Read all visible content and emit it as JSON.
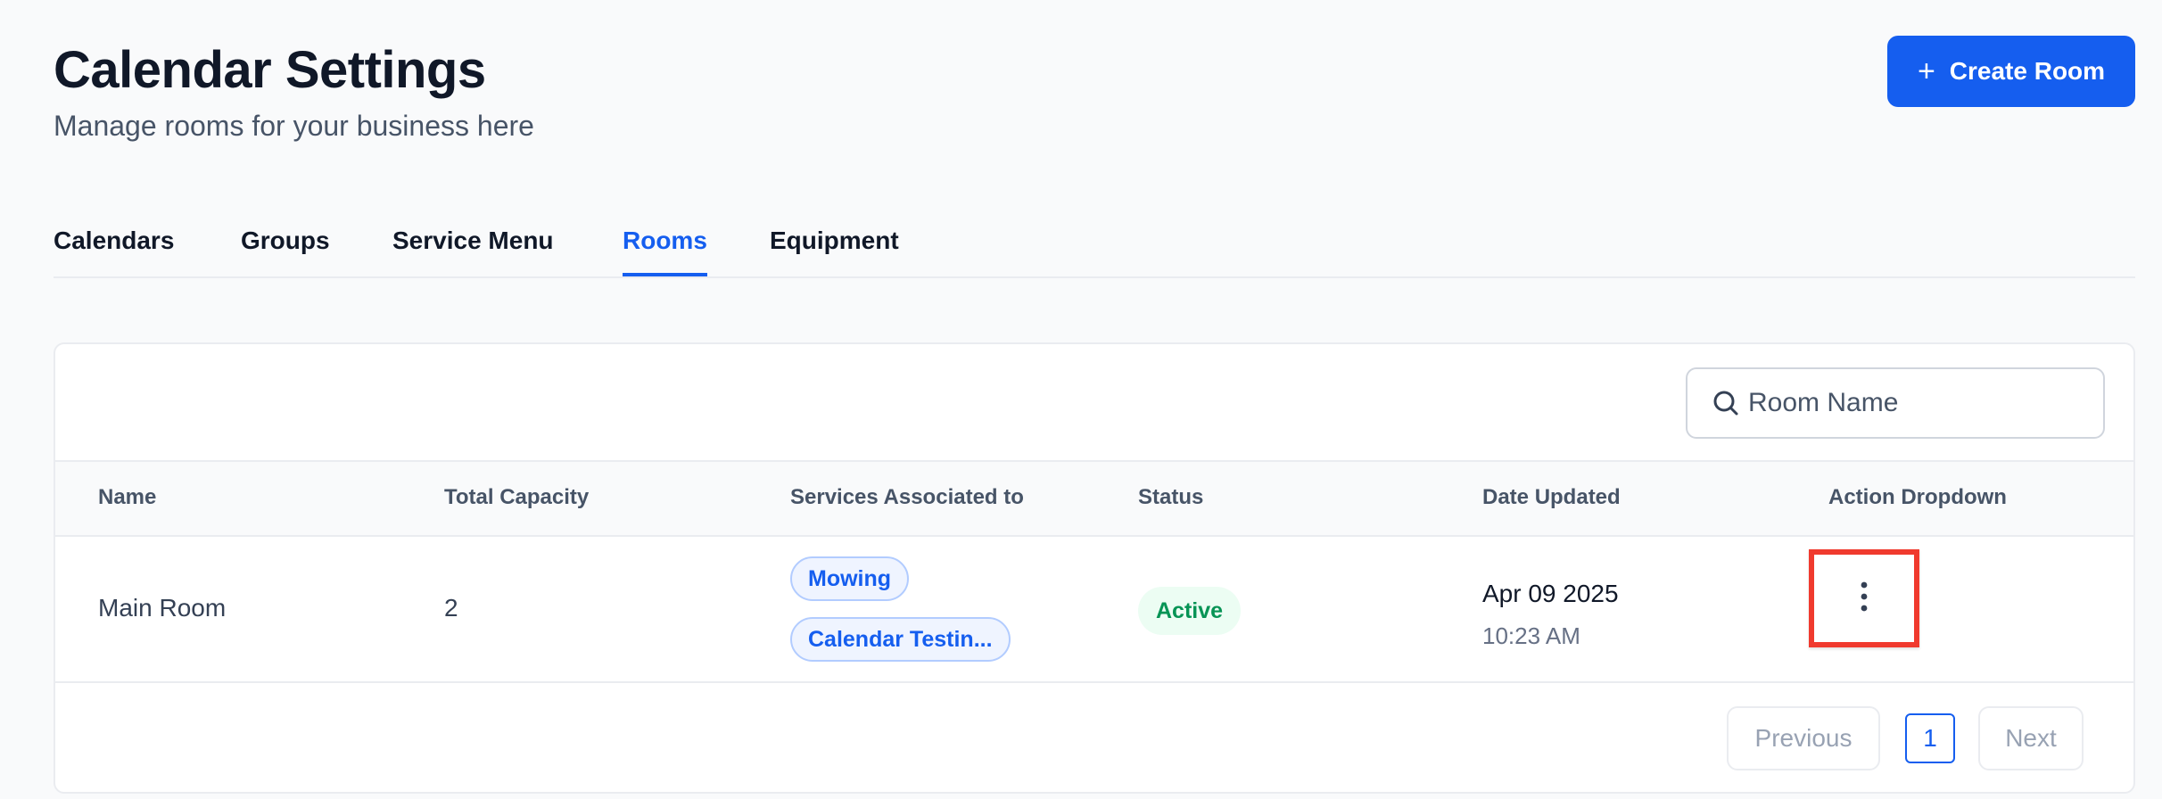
{
  "header": {
    "title": "Calendar Settings",
    "subtitle": "Manage rooms for your business here",
    "create_button": {
      "icon": "plus-icon",
      "label": "Create Room"
    }
  },
  "tabs": [
    {
      "label": "Calendars",
      "active": false
    },
    {
      "label": "Groups",
      "active": false
    },
    {
      "label": "Service Menu",
      "active": false
    },
    {
      "label": "Rooms",
      "active": true
    },
    {
      "label": "Equipment",
      "active": false
    }
  ],
  "search": {
    "icon": "search-icon",
    "placeholder": "Room Name",
    "value": ""
  },
  "table": {
    "columns": [
      "Name",
      "Total Capacity",
      "Services Associated to",
      "Status",
      "Date Updated",
      "Action Dropdown"
    ],
    "rows": [
      {
        "name": "Main Room",
        "capacity": "2",
        "services": [
          "Mowing",
          "Calendar Testin..."
        ],
        "status": "Active",
        "date": "Apr 09 2025",
        "time": "10:23 AM",
        "action_icon": "more-vertical-icon"
      }
    ]
  },
  "pagination": {
    "previous_label": "Previous",
    "current_page": "1",
    "next_label": "Next"
  },
  "colors": {
    "primary": "#155eef",
    "active_status_bg": "#ecfdf3",
    "active_status_text": "#079455",
    "highlight_box": "#f03a2e"
  }
}
